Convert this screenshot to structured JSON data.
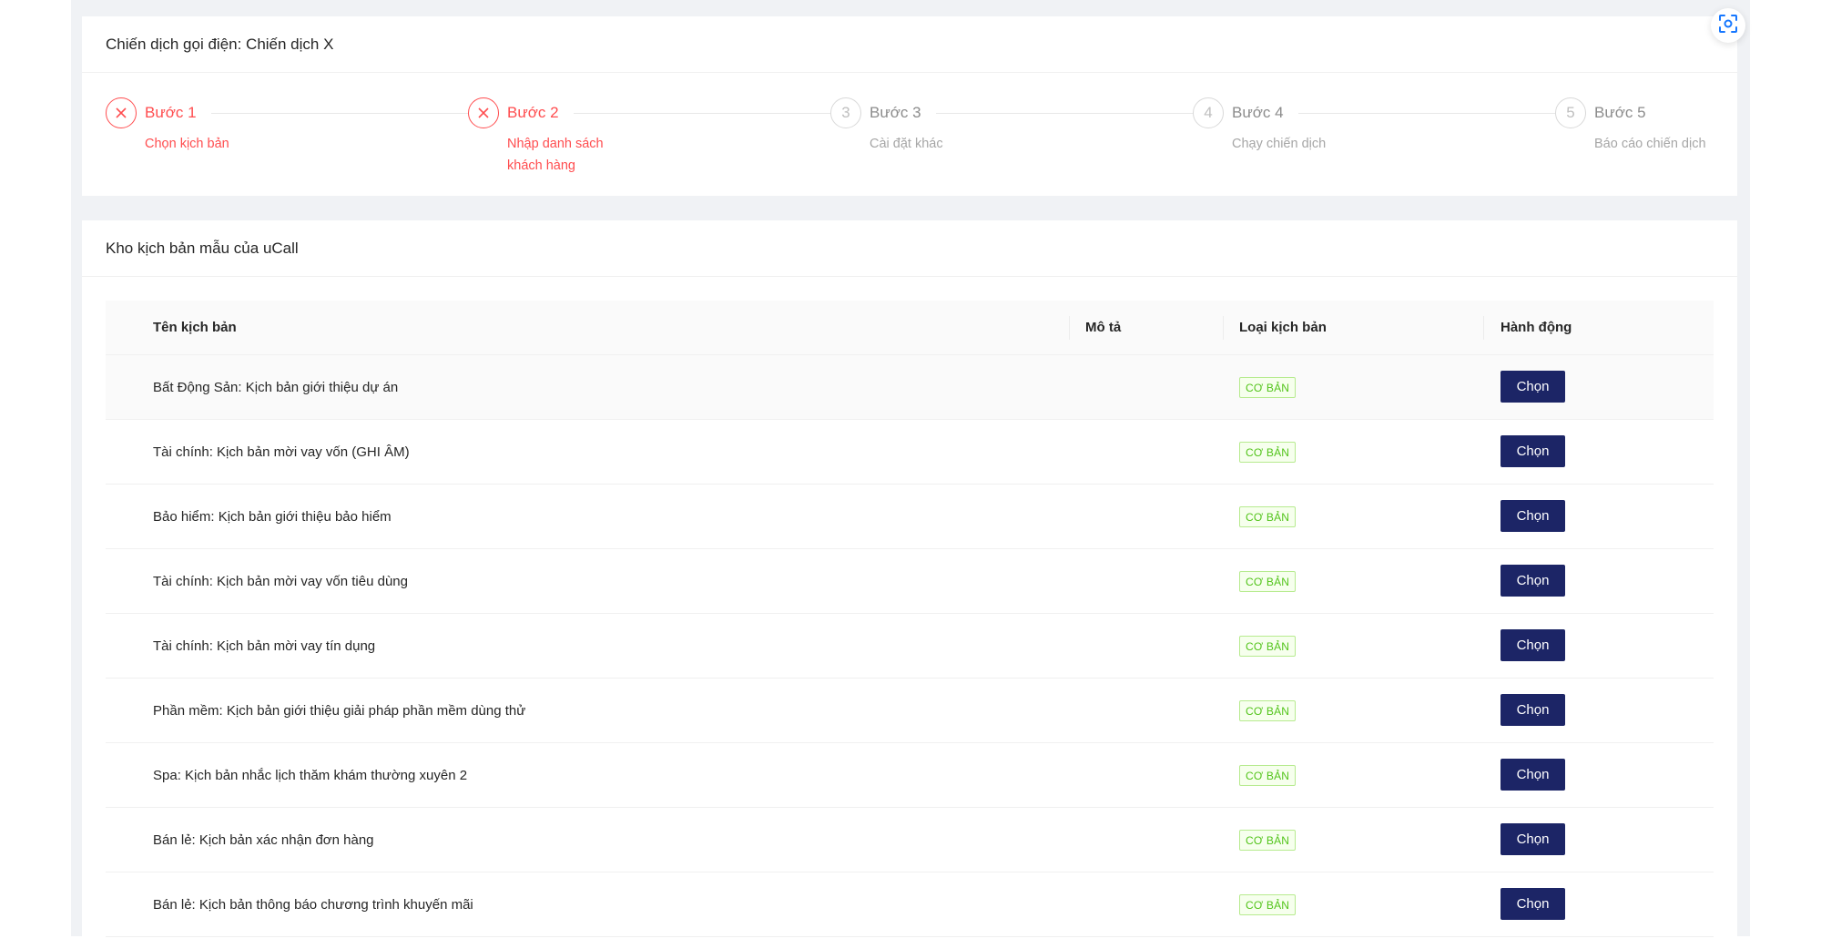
{
  "campaign": {
    "title": "Chiến dịch gọi điện: Chiến dịch X"
  },
  "steps": [
    {
      "title": "Bước 1",
      "description": "Chọn kịch bản",
      "status": "error",
      "icon": "close-icon"
    },
    {
      "title": "Bước 2",
      "description": "Nhập danh sách khách hàng",
      "status": "error",
      "icon": "close-icon"
    },
    {
      "title": "Bước 3",
      "description": "Cài đặt khác",
      "status": "wait",
      "number": "3"
    },
    {
      "title": "Bước 4",
      "description": "Chạy chiến dịch",
      "status": "wait",
      "number": "4"
    },
    {
      "title": "Bước 5",
      "description": "Báo cáo chiến dịch",
      "status": "wait",
      "number": "5"
    }
  ],
  "templates": {
    "title": "Kho kịch bản mẫu của uCall",
    "columns": {
      "name": "Tên kịch bản",
      "description": "Mô tả",
      "type": "Loại kịch bản",
      "action": "Hành động"
    },
    "rows": [
      {
        "name": "Bất Động Sản: Kịch bản giới thiệu dự án",
        "type": "CƠ BẢN",
        "action": "Chọn"
      },
      {
        "name": "Tài chính: Kịch bản mời vay vốn (GHI ÂM)",
        "type": "CƠ BẢN",
        "action": "Chọn"
      },
      {
        "name": "Bảo hiểm: Kịch bản giới thiệu bảo hiểm",
        "type": "CƠ BẢN",
        "action": "Chọn"
      },
      {
        "name": "Tài chính: Kịch bản mời vay vốn tiêu dùng",
        "type": "CƠ BẢN",
        "action": "Chọn"
      },
      {
        "name": "Tài chính: Kịch bản mời vay tín dụng",
        "type": "CƠ BẢN",
        "action": "Chọn"
      },
      {
        "name": "Phần mềm: Kịch bản giới thiệu giải pháp phần mềm dùng thử",
        "type": "CƠ BẢN",
        "action": "Chọn"
      },
      {
        "name": "Spa: Kịch bản nhắc lịch thăm khám thường xuyên 2",
        "type": "CƠ BẢN",
        "action": "Chọn"
      },
      {
        "name": "Bán lẻ: Kịch bản xác nhận đơn hàng",
        "type": "CƠ BẢN",
        "action": "Chọn"
      },
      {
        "name": "Bán lẻ: Kịch bản thông báo chương trình khuyến mãi",
        "type": "CƠ BẢN",
        "action": "Chọn"
      }
    ]
  },
  "colors": {
    "error": "#ff4d4f",
    "primary_button": "#1c2566",
    "tag_green": "#52c41a",
    "page_bg": "#f0f2f5"
  }
}
